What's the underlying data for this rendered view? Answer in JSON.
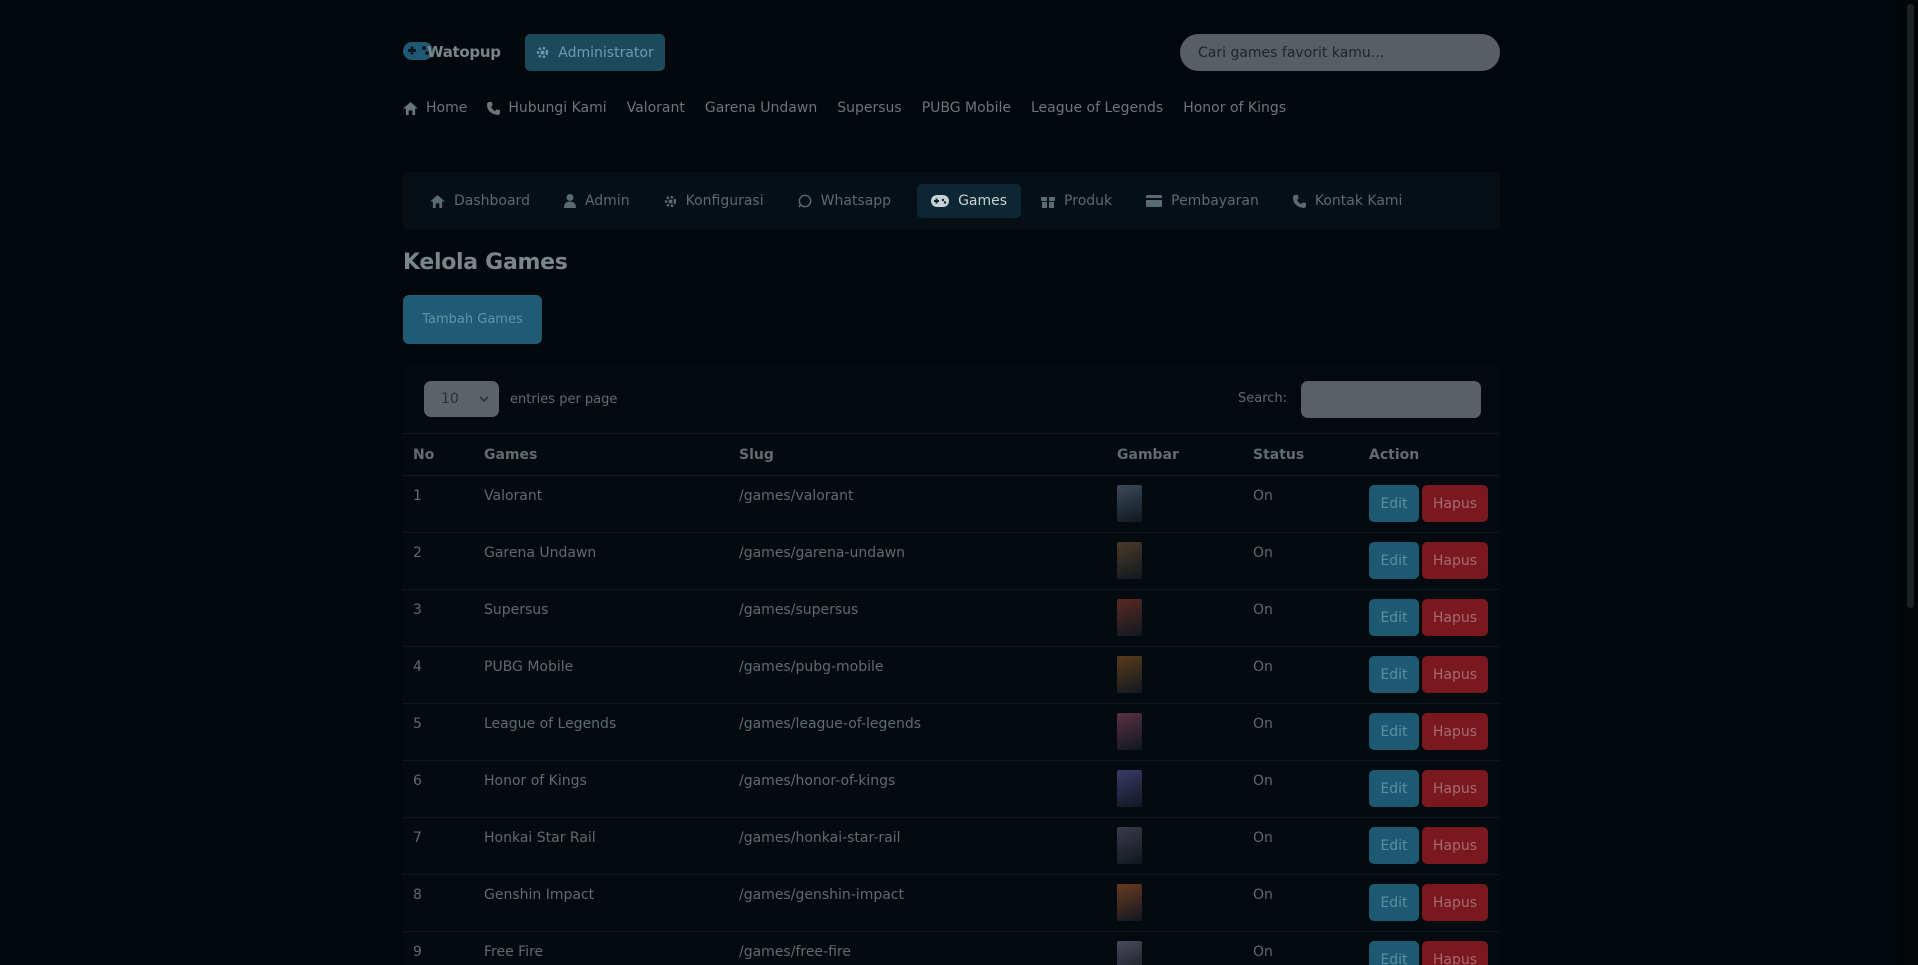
{
  "header": {
    "logo_text": "Watopup",
    "admin_label": "Administrator",
    "search_placeholder": "Cari games favorit kamu..."
  },
  "mainnav": [
    {
      "label": "Home",
      "icon": "home-icon"
    },
    {
      "label": "Hubungi Kami",
      "icon": "phone-icon"
    },
    {
      "label": "Valorant"
    },
    {
      "label": "Garena Undawn"
    },
    {
      "label": "Supersus"
    },
    {
      "label": "PUBG Mobile"
    },
    {
      "label": "League of Legends"
    },
    {
      "label": "Honor of Kings"
    }
  ],
  "adminnav": [
    {
      "label": "Dashboard",
      "icon": "home-icon"
    },
    {
      "label": "Admin",
      "icon": "user-icon"
    },
    {
      "label": "Konfigurasi",
      "icon": "gear-icon"
    },
    {
      "label": "Whatsapp",
      "icon": "whatsapp-icon"
    },
    {
      "label": "Games",
      "icon": "gamepad-icon",
      "active": true
    },
    {
      "label": "Produk",
      "icon": "gift-icon"
    },
    {
      "label": "Pembayaran",
      "icon": "credit-card-icon"
    },
    {
      "label": "Kontak Kami",
      "icon": "phone-icon"
    }
  ],
  "page": {
    "title": "Kelola Games",
    "add_button": "Tambah Games"
  },
  "table_controls": {
    "entries_value": "10",
    "entries_label": "entries per page",
    "search_label": "Search:"
  },
  "table": {
    "headers": [
      "No",
      "Games",
      "Slug",
      "Gambar",
      "Status",
      "Action"
    ],
    "edit_label": "Edit",
    "delete_label": "Hapus",
    "rows": [
      {
        "no": "1",
        "game": "Valorant",
        "slug": "/games/valorant",
        "status": "On",
        "thumb_color": "#3a4a5a"
      },
      {
        "no": "2",
        "game": "Garena Undawn",
        "slug": "/games/garena-undawn",
        "status": "On",
        "thumb_color": "#4a3a28"
      },
      {
        "no": "3",
        "game": "Supersus",
        "slug": "/games/supersus",
        "status": "On",
        "thumb_color": "#5a2a22"
      },
      {
        "no": "4",
        "game": "PUBG Mobile",
        "slug": "/games/pubg-mobile",
        "status": "On",
        "thumb_color": "#5a3a1a"
      },
      {
        "no": "5",
        "game": "League of Legends",
        "slug": "/games/league-of-legends",
        "status": "On",
        "thumb_color": "#5a3040"
      },
      {
        "no": "6",
        "game": "Honor of Kings",
        "slug": "/games/honor-of-kings",
        "status": "On",
        "thumb_color": "#3a3a6a"
      },
      {
        "no": "7",
        "game": "Honkai Star Rail",
        "slug": "/games/honkai-star-rail",
        "status": "On",
        "thumb_color": "#3a3a4a"
      },
      {
        "no": "8",
        "game": "Genshin Impact",
        "slug": "/games/genshin-impact",
        "status": "On",
        "thumb_color": "#6a3a20"
      },
      {
        "no": "9",
        "game": "Free Fire",
        "slug": "/games/free-fire",
        "status": "On",
        "thumb_color": "#4a4a5a"
      }
    ]
  }
}
